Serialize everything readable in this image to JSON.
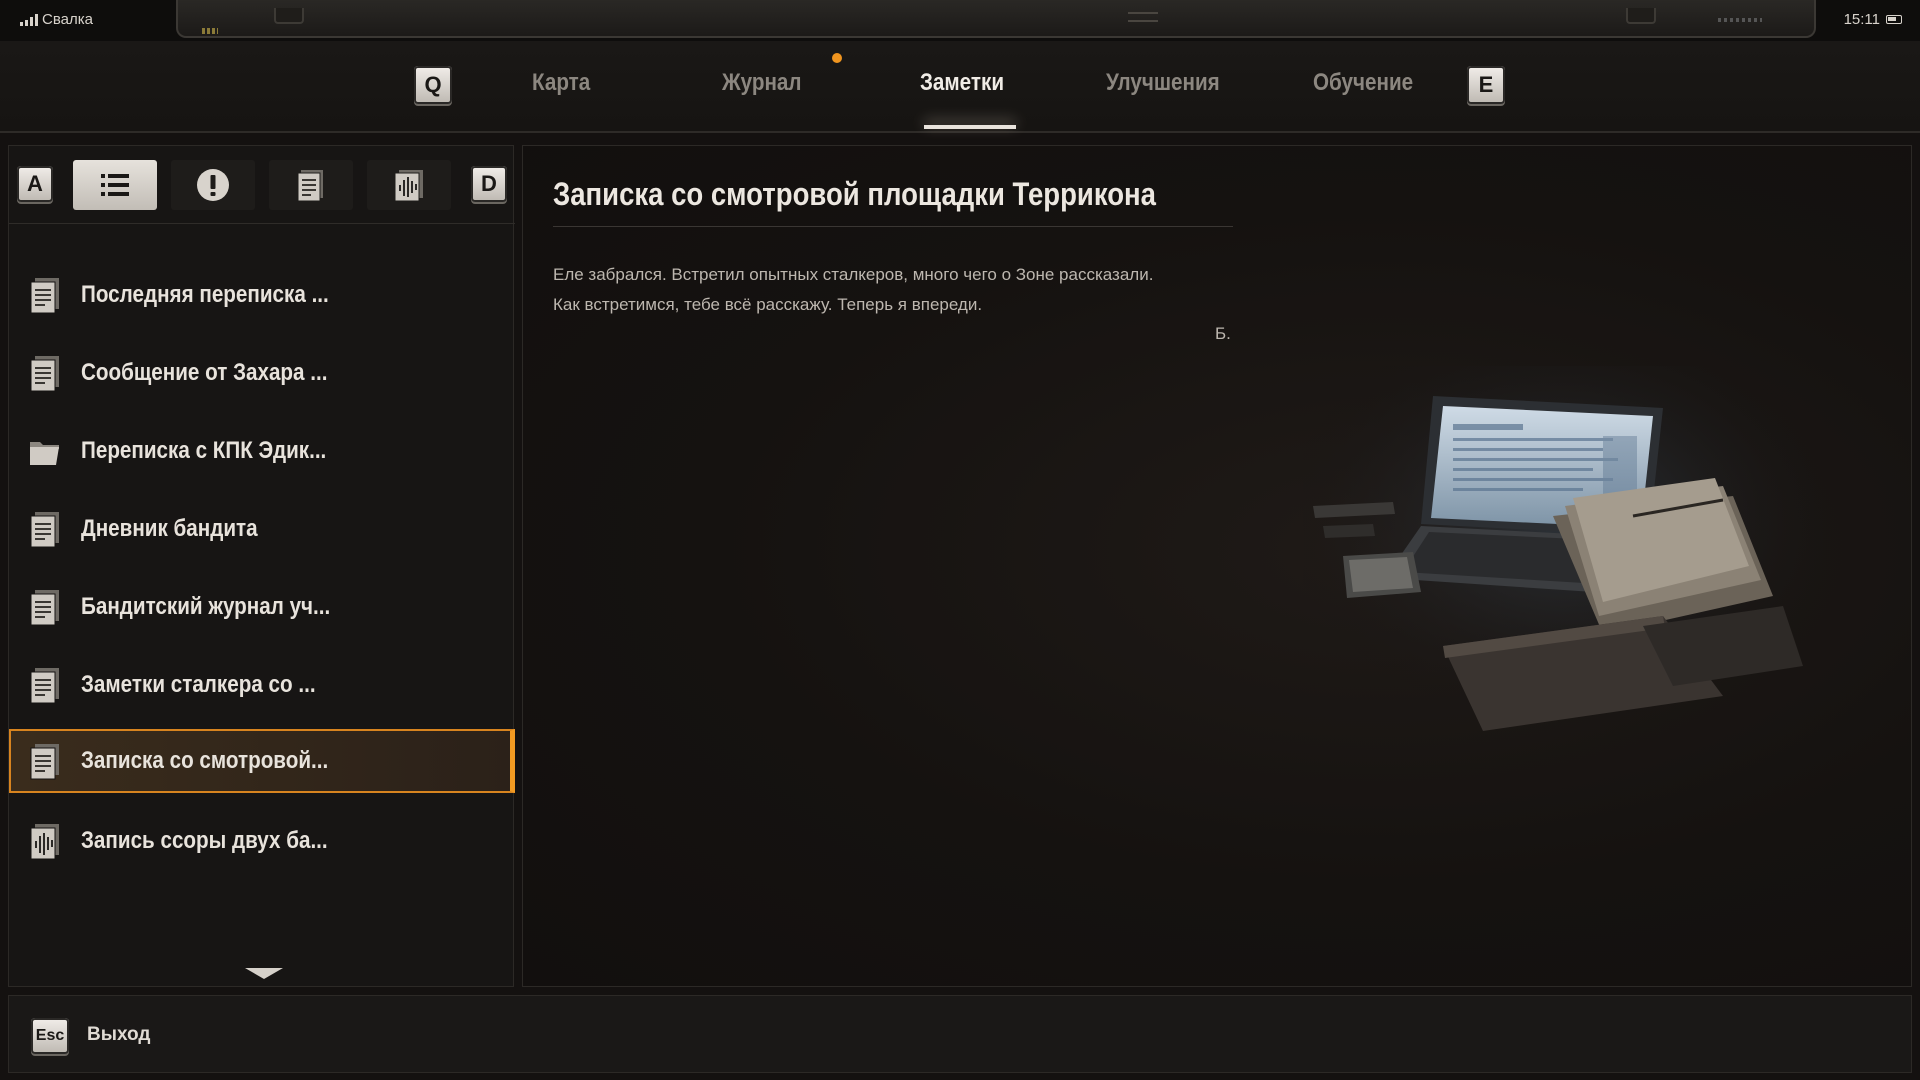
{
  "status_bar": {
    "location": "Свалка",
    "time": "15:11"
  },
  "nav": {
    "prev_key": "Q",
    "next_key": "E",
    "tabs": [
      {
        "label": "Карта",
        "active": false
      },
      {
        "label": "Журнал",
        "active": false,
        "has_notification": true
      },
      {
        "label": "Заметки",
        "active": true
      },
      {
        "label": "Улучшения",
        "active": false
      },
      {
        "label": "Обучение",
        "active": false
      }
    ]
  },
  "filters": {
    "prev_key": "A",
    "next_key": "D",
    "buttons": [
      {
        "icon": "list-icon",
        "active": true
      },
      {
        "icon": "exclamation-icon",
        "active": false
      },
      {
        "icon": "document-icon",
        "active": false
      },
      {
        "icon": "audio-icon",
        "active": false
      }
    ]
  },
  "notes_list": [
    {
      "label": "Последняя переписка ...",
      "icon": "document-icon",
      "selected": false
    },
    {
      "label": "Сообщение от Захара ...",
      "icon": "document-icon",
      "selected": false
    },
    {
      "label": "Переписка с КПК Эдик...",
      "icon": "folder-icon",
      "selected": false
    },
    {
      "label": "Дневник бандита",
      "icon": "document-icon",
      "selected": false
    },
    {
      "label": "Бандитский журнал уч...",
      "icon": "document-icon",
      "selected": false
    },
    {
      "label": "Заметки сталкера со ...",
      "icon": "document-icon",
      "selected": false
    },
    {
      "label": "Записка со смотровой...",
      "icon": "document-icon",
      "selected": true
    },
    {
      "label": "Запись ссоры двух ба...",
      "icon": "audio-icon",
      "selected": false
    }
  ],
  "note": {
    "title": "Записка со смотровой площадки Террикона",
    "body_line1": " Еле забрался. Встретил опытных сталкеров, много чего о Зоне рассказали.",
    "body_line2": "Как встретимся, тебе всё расскажу. Теперь я впереди.",
    "signature": "Б."
  },
  "footer": {
    "exit_key": "Esc",
    "exit_label": "Выход"
  },
  "colors": {
    "accent": "#f29a22",
    "notification_dot": "#f0951f"
  }
}
